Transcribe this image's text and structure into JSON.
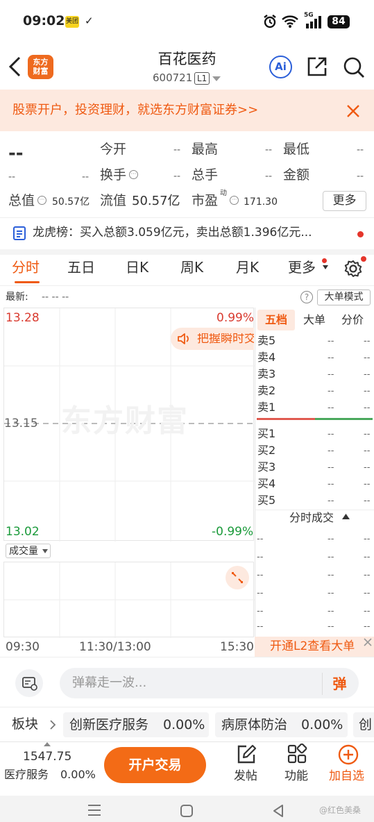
{
  "status_bar": {
    "time": "09:02",
    "app_badge": "美团",
    "check": "✓",
    "signal_label": "5G",
    "battery": "84"
  },
  "header": {
    "title": "百花医药",
    "code": "600721",
    "level": "L1",
    "logo_text_1": "东方",
    "logo_text_2": "财富",
    "ai_label": "Ai"
  },
  "banner": {
    "text": "股票开户，投资理财，就选东方财富证券>>"
  },
  "quote": {
    "price": "--",
    "change": "--",
    "change_pct": "--",
    "open_label": "今开",
    "open_value": "--",
    "high_label": "最高",
    "high_value": "--",
    "low_label": "最低",
    "low_value": "--",
    "turnover_label": "换手",
    "turnover_value": "--",
    "volume_label": "总手",
    "volume_value": "--",
    "amount_label": "金额",
    "amount_value": "--",
    "mktcap_label": "总值",
    "mktcap_value": "50.57亿",
    "float_label": "流值",
    "float_value": "50.57亿",
    "pe_label": "市盈",
    "pe_sup": "动",
    "pe_value": "171.30",
    "more_button": "更多"
  },
  "dragon_tiger": {
    "text": "龙虎榜：买入总额3.059亿元，卖出总额1.396亿元..."
  },
  "tabs": [
    {
      "label": "分时",
      "active": true
    },
    {
      "label": "五日",
      "active": false
    },
    {
      "label": "日K",
      "active": false
    },
    {
      "label": "周K",
      "active": false
    },
    {
      "label": "月K",
      "active": false
    },
    {
      "label": "更多",
      "active": false
    }
  ],
  "chart_header": {
    "latest_label": "最新:",
    "latest_value": "-- -- --",
    "big_order_button": "大单模式"
  },
  "intraday_chart": {
    "price_high": "13.28",
    "price_mid": "13.15",
    "price_low": "13.02",
    "pct_high": "0.99%",
    "pct_low": "-0.99%",
    "watermark": "东方财富",
    "tip": "把握瞬时交",
    "volume_selector": "成交量",
    "time_start": "09:30",
    "time_mid": "11:30/13:00",
    "time_end": "15:30"
  },
  "order_book": {
    "tabs": [
      "五档",
      "大单",
      "分价"
    ],
    "active_tab": "五档",
    "sells": [
      {
        "label": "卖5",
        "price": "--",
        "volume": "--"
      },
      {
        "label": "卖4",
        "price": "--",
        "volume": "--"
      },
      {
        "label": "卖3",
        "price": "--",
        "volume": "--"
      },
      {
        "label": "卖2",
        "price": "--",
        "volume": "--"
      },
      {
        "label": "卖1",
        "price": "--",
        "volume": "--"
      }
    ],
    "buys": [
      {
        "label": "买1",
        "price": "--",
        "volume": "--"
      },
      {
        "label": "买2",
        "price": "--",
        "volume": "--"
      },
      {
        "label": "买3",
        "price": "--",
        "volume": "--"
      },
      {
        "label": "买4",
        "price": "--",
        "volume": "--"
      },
      {
        "label": "买5",
        "price": "--",
        "volume": "--"
      }
    ],
    "trades_title": "分时成交",
    "trades": [
      {
        "a": "--",
        "b": "--",
        "c": "--"
      },
      {
        "a": "--",
        "b": "--",
        "c": "--"
      },
      {
        "a": "--",
        "b": "--",
        "c": "--"
      },
      {
        "a": "--",
        "b": "--",
        "c": "--"
      },
      {
        "a": "--",
        "b": "--",
        "c": "--"
      },
      {
        "a": "--",
        "b": "--",
        "c": "--"
      }
    ],
    "l2_link": "开通L2查看大单"
  },
  "danmaku": {
    "placeholder": "弹幕走一波...",
    "send_label": "弹"
  },
  "sectors": {
    "label": "板块",
    "items": [
      {
        "name": "创新医疗服务",
        "pct": "0.00%"
      },
      {
        "name": "病原体防治",
        "pct": "0.00%"
      },
      {
        "name": "创",
        "pct": ""
      }
    ]
  },
  "bottom_bar": {
    "index_value": "1547.75",
    "index_name": "医疗服务",
    "index_pct": "0.00%",
    "trade_button": "开户交易",
    "post_label": "发帖",
    "function_label": "功能",
    "watch_label": "加自选"
  },
  "nav": {
    "watermark": "@红色美桑"
  },
  "colors": {
    "accent": "#ef5a12",
    "red": "#d93b30",
    "green": "#1a9a3a",
    "banner_bg": "#fde9df",
    "blue": "#2b5fd9"
  }
}
